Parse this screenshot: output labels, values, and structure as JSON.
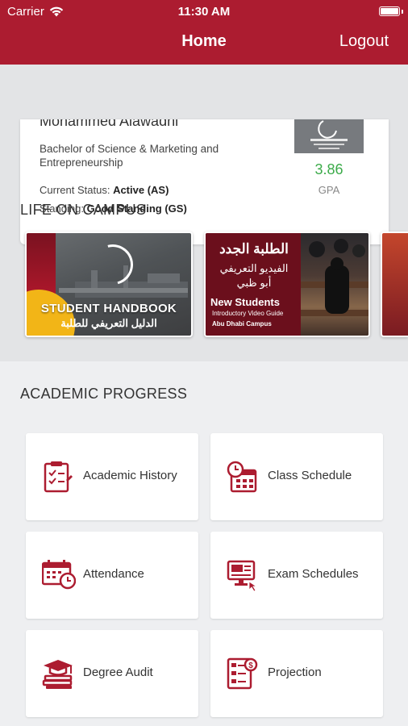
{
  "status_bar": {
    "carrier": "Carrier",
    "time": "11:30 AM"
  },
  "nav": {
    "title": "Home",
    "logout": "Logout"
  },
  "profile": {
    "name": "Mohammed Alawadhi",
    "degree": "Bachelor of Science & Marketing and Entrepreneurship",
    "current_status_label": "Current Status:",
    "current_status_value": "Active (AS)",
    "standing_label": "Standing:",
    "standing_value": "Good Standing (GS)",
    "gpa_value": "3.86",
    "gpa_label": "GPA",
    "gpa_color": "#3cab4a"
  },
  "life_on_campus": {
    "title": "LIFE ON CAMPUS",
    "banners": [
      {
        "title": "STUDENT HANDBOOK",
        "subtitle_ar": "الدليل التعريفي للطلبة"
      },
      {
        "title_ar": "الطلبة الجدد",
        "subtitle_ar_1": "الفيديو التعريفي",
        "subtitle_ar_2": "أبو ظبي",
        "title": "New Students",
        "subtitle": "Introductory Video Guide",
        "campus": "Abu Dhabi Campus"
      }
    ]
  },
  "academic_progress": {
    "title": "ACADEMIC PROGRESS",
    "tiles": [
      {
        "label": "Academic History",
        "icon": "clipboard-checklist-icon"
      },
      {
        "label": "Class Schedule",
        "icon": "calendar-clock-icon"
      },
      {
        "label": "Attendance",
        "icon": "calendar-stopwatch-icon"
      },
      {
        "label": "Exam Schedules",
        "icon": "monitor-chart-icon"
      },
      {
        "label": "Degree Audit",
        "icon": "graduation-cap-books-icon"
      },
      {
        "label": "Projection",
        "icon": "document-list-icon"
      }
    ]
  },
  "colors": {
    "brand": "#ac1c30",
    "accent_green": "#3cab4a"
  }
}
